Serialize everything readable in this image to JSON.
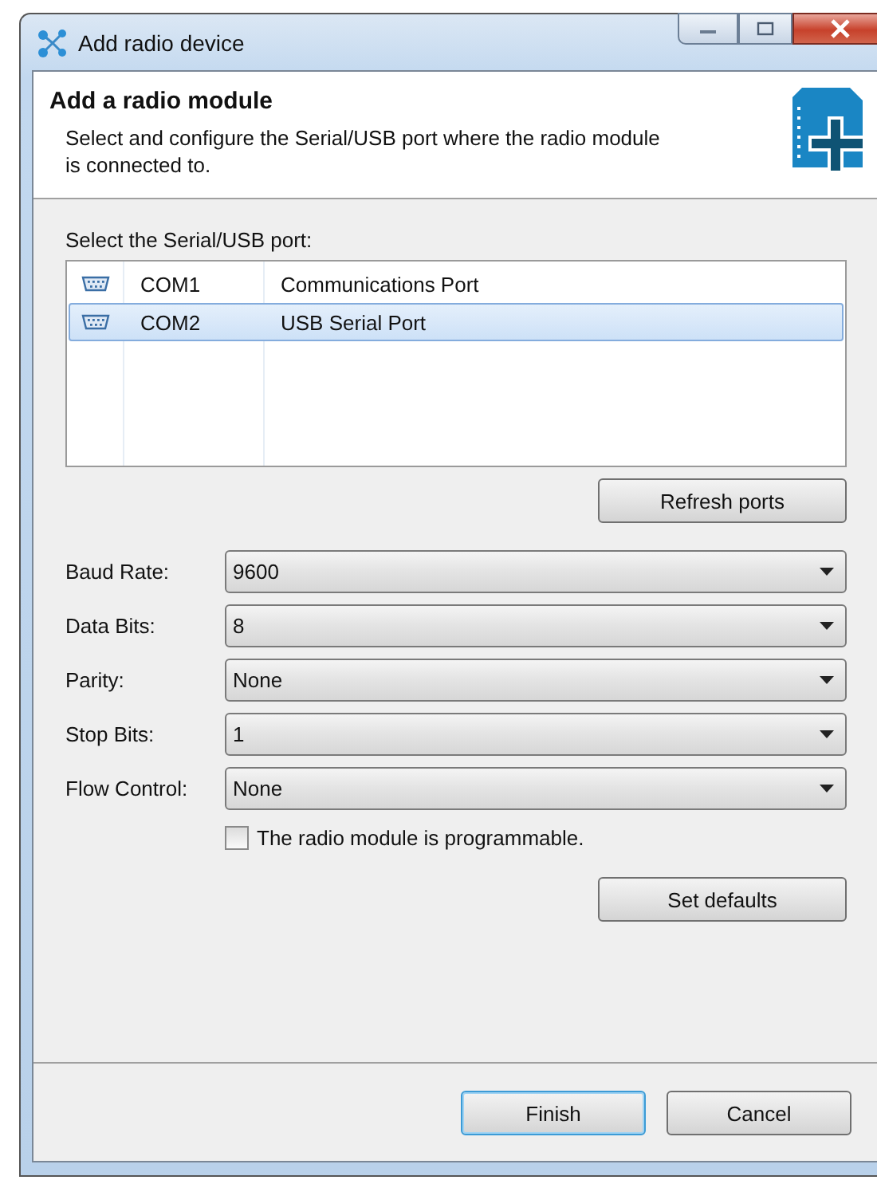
{
  "window": {
    "title": "Add radio device"
  },
  "header": {
    "title": "Add a radio module",
    "description": "Select and configure the Serial/USB port where the radio module is connected to."
  },
  "port_list": {
    "label": "Select the Serial/USB port:",
    "rows": [
      {
        "port": "COM1",
        "description": "Communications Port",
        "selected": false
      },
      {
        "port": "COM2",
        "description": "USB Serial Port",
        "selected": true
      }
    ]
  },
  "refresh_button": "Refresh ports",
  "settings": [
    {
      "label": "Baud Rate:",
      "value": "9600"
    },
    {
      "label": "Data Bits:",
      "value": "8"
    },
    {
      "label": "Parity:",
      "value": "None"
    },
    {
      "label": "Stop Bits:",
      "value": "1"
    },
    {
      "label": "Flow Control:",
      "value": "None"
    }
  ],
  "programmable": {
    "label": "The radio module is programmable.",
    "checked": false
  },
  "defaults_button": "Set defaults",
  "buttons": [
    {
      "label": "Finish",
      "default": true
    },
    {
      "label": "Cancel",
      "default": false
    }
  ]
}
